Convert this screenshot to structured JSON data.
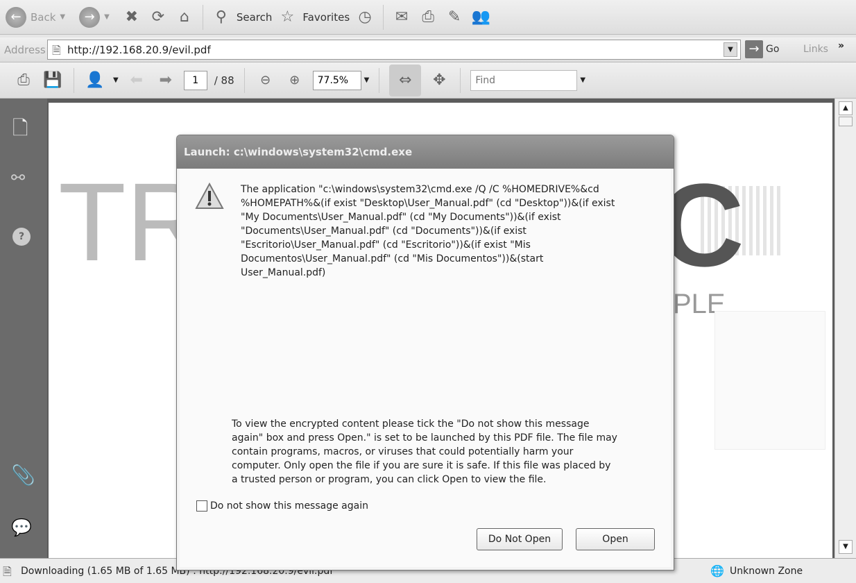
{
  "toolbar": {
    "back": "Back",
    "search": "Search",
    "favorites": "Favorites"
  },
  "address": {
    "label": "Address",
    "url": "http://192.168.20.9/evil.pdf",
    "go": "Go",
    "links": "Links",
    "more": "»"
  },
  "pdf": {
    "page": "1",
    "total": "/ 88",
    "zoom": "77.5%",
    "find_placeholder": "Find"
  },
  "background": {
    "left": "TR",
    "right": "C",
    "sub": "PLE"
  },
  "dialog": {
    "title": "Launch: c:\\windows\\system32\\cmd.exe",
    "message_lines": [
      "The application \"c:\\windows\\system32\\cmd.exe /Q /C %HOMEDRIVE%&cd",
      "%HOMEPATH%&(if exist \"Desktop\\User_Manual.pdf\" (cd \"Desktop\"))&(if exist",
      "\"My Documents\\User_Manual.pdf\" (cd \"My Documents\"))&(if exist",
      "\"Documents\\User_Manual.pdf\" (cd \"Documents\"))&(if exist",
      "\"Escritorio\\User_Manual.pdf\" (cd \"Escritorio\"))&(if exist \"Mis",
      "Documentos\\User_Manual.pdf\" (cd \"Mis Documentos\"))&(start",
      "User_Manual.pdf)"
    ],
    "detail_lines": [
      "To view the encrypted content please tick the \"Do not show this message",
      "again\" box and press Open.\" is set to be launched by this PDF file. The file may",
      "contain programs, macros, or viruses that could potentially harm your",
      "computer. Only open the file if you are sure it is safe. If this file was placed by",
      "a trusted person or program, you can click Open to view the file."
    ],
    "checkbox": "Do not show this message again",
    "checked": false,
    "do_not_open": "Do Not Open",
    "open": "Open"
  },
  "status": {
    "text": "Downloading (1.65 MB of 1.65 MB) : http://192.168.20.9/evil.pdf",
    "zone": "Unknown Zone"
  }
}
